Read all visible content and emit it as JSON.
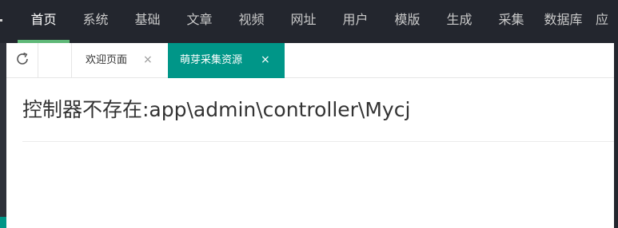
{
  "nav": {
    "items": [
      "首页",
      "系统",
      "基础",
      "文章",
      "视频",
      "网址",
      "用户",
      "模版",
      "生成",
      "采集",
      "数据库",
      "应"
    ],
    "active_index": 0
  },
  "tabs": [
    {
      "label": "欢迎页面",
      "close": "×",
      "active": false
    },
    {
      "label": "萌芽采集资源",
      "close": "×",
      "active": true
    }
  ],
  "toolbar": {
    "refresh_icon": "refresh-icon"
  },
  "content": {
    "error_message": "控制器不存在:app\\admin\\controller\\Mycj"
  },
  "colors": {
    "topbar": "#23262e",
    "active_tab": "#009688",
    "nav_active_underline": "#5fb878"
  }
}
